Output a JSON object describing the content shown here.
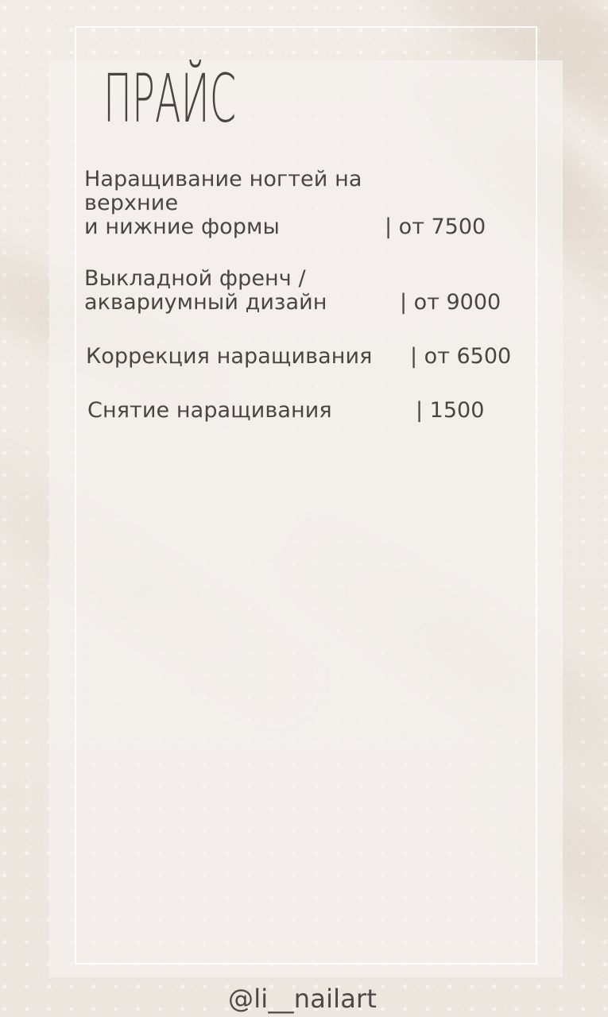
{
  "title": "ПРАЙС",
  "items": [
    {
      "service": "Наращивание ногтей на\nверхние\nи нижние формы",
      "price": "| от 7500"
    },
    {
      "service": "Выкладной френч /\nаквариумный дизайн",
      "price": "| от 9000"
    },
    {
      "service": "Коррекция наращивания",
      "price": "| от 6500"
    },
    {
      "service": "Снятие наращивания",
      "price": "| 1500"
    }
  ],
  "footer": {
    "handle": "@li__nailart"
  },
  "colors": {
    "text": "#4a4541",
    "panel": "#f4f1ee",
    "background": "#efe9e1",
    "accent_shadow": "#b8a58c",
    "frame": "#ffffff"
  }
}
